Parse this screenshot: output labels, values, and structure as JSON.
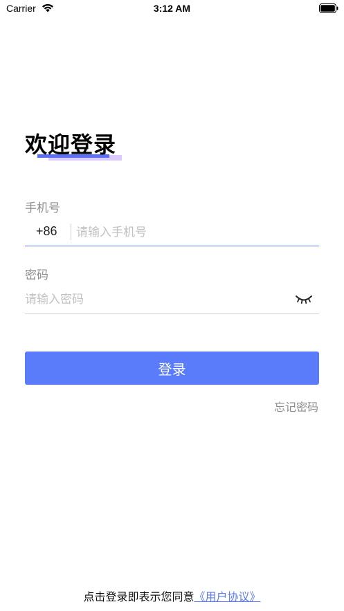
{
  "status_bar": {
    "carrier": "Carrier",
    "time": "3:12 AM",
    "wifi_icon": "wifi-icon",
    "battery_icon": "battery-icon"
  },
  "welcome": {
    "title": "欢迎登录"
  },
  "phone": {
    "label": "手机号",
    "country_code": "+86",
    "placeholder": "请输入手机号",
    "value": ""
  },
  "password": {
    "label": "密码",
    "placeholder": "请输入密码",
    "value": "",
    "toggle_icon": "eye-closed-icon"
  },
  "login_button": {
    "label": "登录"
  },
  "forgot_password": {
    "label": "忘记密码"
  },
  "agreement": {
    "prefix": "点击登录即表示您同意",
    "link": "《用户协议》"
  },
  "colors": {
    "accent": "#5a7bfa",
    "input_focus_line": "#5a7dff",
    "highlight": "#dbcafd",
    "placeholder": "#c2c2c2",
    "label": "#8e8e8e"
  }
}
